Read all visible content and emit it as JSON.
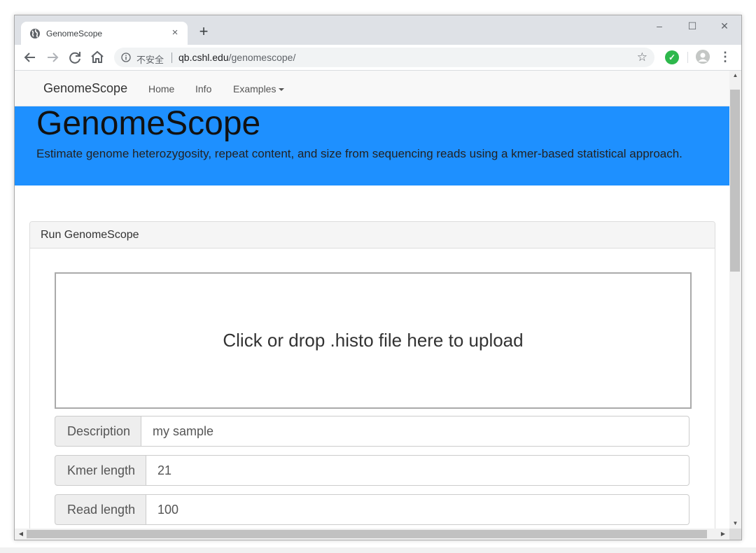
{
  "browser": {
    "tab_title": "GenomeScope",
    "tab_close": "×",
    "new_tab": "+",
    "security_label": "不安全",
    "url_host": "qb.cshl.edu",
    "url_path": "/genomescope/",
    "window_controls": {
      "minimize": "–",
      "maximize": "☐",
      "close": "✕"
    }
  },
  "navbar": {
    "brand": "GenomeScope",
    "links": [
      {
        "label": "Home"
      },
      {
        "label": "Info"
      },
      {
        "label": "Examples"
      }
    ]
  },
  "hero": {
    "title": "GenomeScope",
    "subtitle": "Estimate genome heterozygosity, repeat content, and size from sequencing reads using a kmer-based statistical approach."
  },
  "panel": {
    "title": "Run GenomeScope",
    "dropzone_text": "Click or drop .histo file here to upload",
    "fields": [
      {
        "label": "Description",
        "value": "my sample"
      },
      {
        "label": "Kmer length",
        "value": "21"
      },
      {
        "label": "Read length",
        "value": "100"
      }
    ]
  },
  "colors": {
    "hero_background": "#1e90ff",
    "extension_badge": "#2db84c"
  }
}
